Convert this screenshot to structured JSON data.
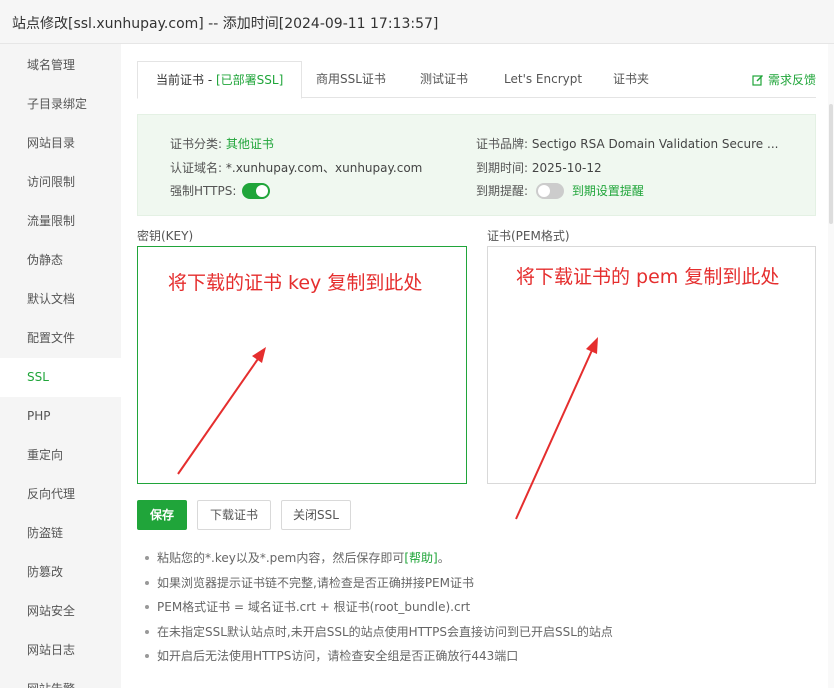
{
  "dialog": {
    "title": "站点修改[ssl.xunhupay.com] -- 添加时间[2024-09-11 17:13:57]"
  },
  "sidebar": {
    "items": [
      {
        "label": "域名管理"
      },
      {
        "label": "子目录绑定"
      },
      {
        "label": "网站目录"
      },
      {
        "label": "访问限制"
      },
      {
        "label": "流量限制"
      },
      {
        "label": "伪静态"
      },
      {
        "label": "默认文档"
      },
      {
        "label": "配置文件"
      },
      {
        "label": "SSL"
      },
      {
        "label": "PHP"
      },
      {
        "label": "重定向"
      },
      {
        "label": "反向代理"
      },
      {
        "label": "防盗链"
      },
      {
        "label": "防篡改"
      },
      {
        "label": "网站安全"
      },
      {
        "label": "网站日志"
      },
      {
        "label": "网站告警"
      }
    ],
    "active": "SSL"
  },
  "tabs": {
    "current_prefix": "当前证书 - ",
    "current_status": "[已部署SSL]",
    "items": [
      {
        "label": "商用SSL证书"
      },
      {
        "label": "测试证书"
      },
      {
        "label": "Let's Encrypt"
      },
      {
        "label": "证书夹"
      }
    ],
    "feedback": "需求反馈"
  },
  "info": {
    "category_label": "证书分类:",
    "category_value": "其他证书",
    "domain_label": "认证域名:",
    "domain_value": "*.xunhupay.com、xunhupay.com",
    "https_label": "强制HTTPS:",
    "https_enabled": true,
    "brand_label": "证书品牌:",
    "brand_value": "Sectigo RSA Domain Validation Secure ...",
    "expire_label": "到期时间:",
    "expire_value": "2025-10-12",
    "remind_label": "到期提醒:",
    "remind_enabled": false,
    "remind_link": "到期设置提醒"
  },
  "key_field": {
    "label": "密钥(KEY)",
    "value": "",
    "annotation": "将下载的证书 key 复制到此处"
  },
  "cert_field": {
    "label": "证书(PEM格式)",
    "value": "",
    "annotation": "将下载证书的 pem 复制到此处"
  },
  "buttons": {
    "save": "保存",
    "download": "下载证书",
    "close_ssl": "关闭SSL"
  },
  "tips": [
    {
      "text": "粘贴您的*.key以及*.pem内容，然后保存即可",
      "link": "[帮助]",
      "suffix": "。"
    },
    {
      "text": "如果浏览器提示证书链不完整,请检查是否正确拼接PEM证书"
    },
    {
      "text": "PEM格式证书 = 域名证书.crt + 根证书(root_bundle).crt"
    },
    {
      "text": "在未指定SSL默认站点时,未开启SSL的站点使用HTTPS会直接访问到已开启SSL的站点"
    },
    {
      "text": "如开启后无法使用HTTPS访问，请检查安全组是否正确放行443端口"
    }
  ],
  "colors": {
    "accent": "#20a53a",
    "annotation": "#e52e2e",
    "panel_bg": "#f0f8f0"
  }
}
